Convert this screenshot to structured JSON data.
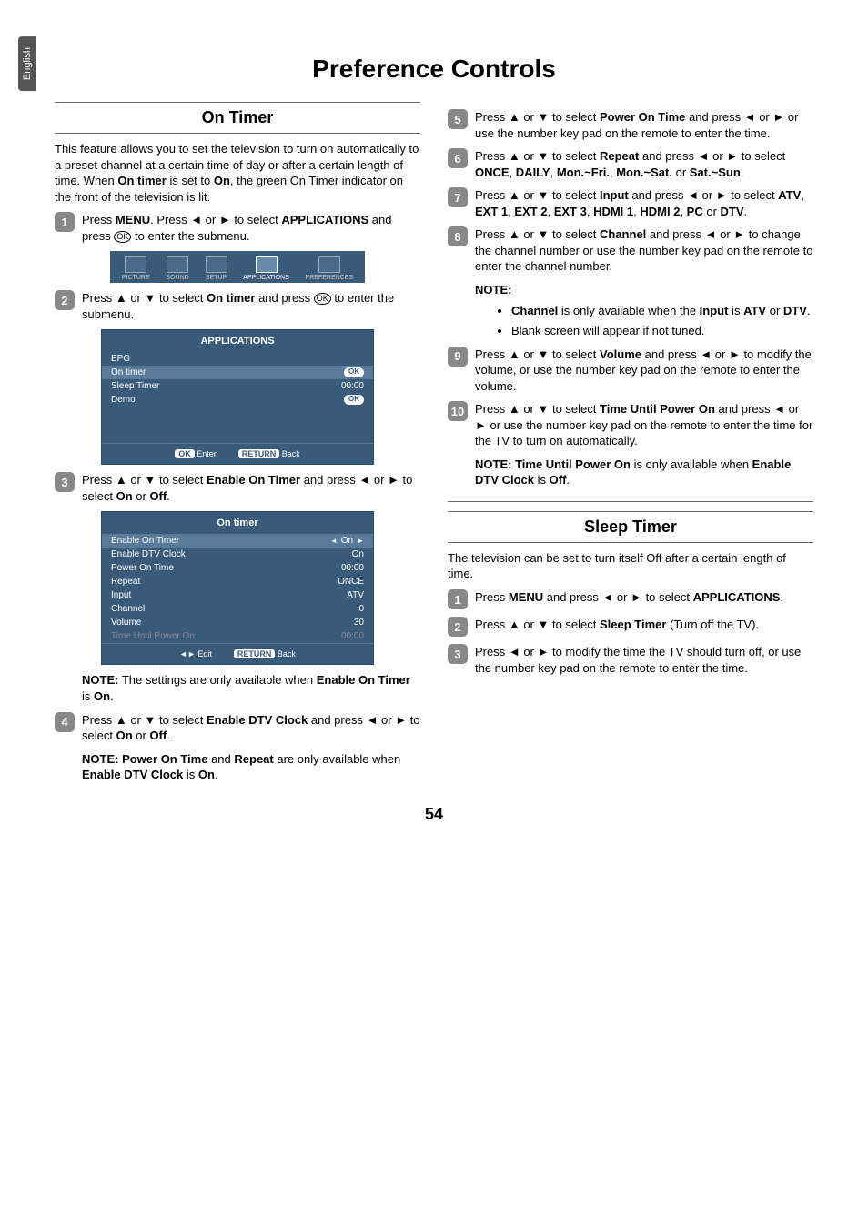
{
  "langTab": "English",
  "mainTitle": "Preference Controls",
  "pageNumber": "54",
  "left": {
    "sectionTitle": "On Timer",
    "intro": "This feature allows you to set the television to turn on automatically to a preset channel at a certain time of day or after a certain length of time. When ",
    "introB1": "On timer",
    "introMid": " is set to ",
    "introB2": "On",
    "introEnd": ", the green On Timer indicator on the front of the television is lit.",
    "s1a": "Press ",
    "s1b": "MENU",
    "s1c": ". Press ◄ or ► to select ",
    "s1d": "APPLICATIONS",
    "s1e": " and press ",
    "s1f": " to enter the submenu.",
    "okGlyph": "OK",
    "s2a": "Press ▲ or ▼ to select ",
    "s2b": "On timer",
    "s2c": " and press ",
    "s2d": " to enter the submenu.",
    "s3a": "Press ▲ or ▼ to select ",
    "s3b": "Enable On Timer",
    "s3c": " and press ◄ or ► to select ",
    "s3d": "On",
    "s3e": " or ",
    "s3f": "Off",
    "s3g": ".",
    "note3Label": "NOTE:",
    "note3a": " The settings are only available when ",
    "note3b": "Enable On Timer",
    "note3c": " is ",
    "note3d": "On",
    "note3e": ".",
    "s4a": "Press ▲ or ▼ to select ",
    "s4b": "Enable DTV Clock",
    "s4c": " and press ◄ or ► to select ",
    "s4d": "On",
    "s4e": " or ",
    "s4f": "Off",
    "s4g": ".",
    "note4Label": "NOTE:",
    "note4a": " Power On Time",
    "note4b": " and ",
    "note4c": "Repeat",
    "note4d": " are only available when ",
    "note4e": "Enable DTV Clock",
    "note4f": " is ",
    "note4g": "On",
    "note4h": "."
  },
  "right": {
    "s5a": "Press ▲ or ▼ to select ",
    "s5b": "Power On Time",
    "s5c": " and press ◄ or ► or use the number key pad on the remote to enter the time.",
    "s6a": "Press ▲ or ▼ to select ",
    "s6b": "Repeat",
    "s6c": " and press ◄ or ► to select ",
    "s6d": "ONCE",
    "s6e": ", ",
    "s6f": "DAILY",
    "s6g": ", ",
    "s6h": "Mon.~Fri.",
    "s6i": ", ",
    "s6j": "Mon.~Sat.",
    "s6k": " or ",
    "s6l": "Sat.~Sun",
    "s6m": ".",
    "s7a": "Press ▲ or ▼ to select ",
    "s7b": "Input",
    "s7c": " and press ◄ or ► to select ",
    "s7d": "ATV",
    "s7e": ", ",
    "s7f": "EXT 1",
    "s7g": ", ",
    "s7h": "EXT 2",
    "s7i": ", ",
    "s7j": "EXT 3",
    "s7k": ", ",
    "s7l": "HDMI 1",
    "s7m": ", ",
    "s7n": "HDMI 2",
    "s7o": ", ",
    "s7p": "PC",
    "s7q": " or ",
    "s7r": "DTV",
    "s7s": ".",
    "s8a": "Press ▲ or ▼ to select ",
    "s8b": "Channel",
    "s8c": " and press ◄ or ► to change the channel number or use the number key pad on the remote to enter the channel number.",
    "note8Label": "NOTE:",
    "b1a": "Channel",
    "b1b": " is only available when the ",
    "b1c": "Input",
    "b1d": " is ",
    "b1e": "ATV",
    "b1f": " or ",
    "b1g": "DTV",
    "b1h": ".",
    "b2": "Blank screen will appear if not tuned.",
    "s9a": "Press ▲ or ▼ to select ",
    "s9b": "Volume",
    "s9c": " and press ◄ or ► to modify the volume, or use the number key pad on the remote to enter the volume.",
    "s10a": "Press ▲ or ▼ to select ",
    "s10b": "Time Until Power On",
    "s10c": " and press ◄ or ► or use the number key pad on the remote to enter the time for the TV to turn on automatically.",
    "note10Label": "NOTE:",
    "note10a": " Time Until Power On",
    "note10b": " is only available when ",
    "note10c": "Enable DTV Clock",
    "note10d": " is ",
    "note10e": "Off",
    "note10f": ".",
    "sleepTitle": "Sleep Timer",
    "sleepIntro": "The television can be set to turn itself Off after a certain length of time.",
    "sl1a": "Press ",
    "sl1b": "MENU",
    "sl1c": " and press ◄ or ► to select ",
    "sl1d": "APPLICATIONS",
    "sl1e": ".",
    "sl2a": "Press ▲ or ▼ to select ",
    "sl2b": "Sleep Timer",
    "sl2c": " (Turn off the TV).",
    "sl3": "Press ◄ or ► to modify the time the TV should turn off, or use the number key pad on the remote to enter the time."
  },
  "menuBar": {
    "items": [
      "PICTURE",
      "SOUND",
      "SETUP",
      "APPLICATIONS",
      "PREFERENCES"
    ]
  },
  "osd1": {
    "title": "APPLICATIONS",
    "rows": [
      {
        "label": "EPG",
        "value": ""
      },
      {
        "label": "On timer",
        "value": "OK"
      },
      {
        "label": "Sleep Timer",
        "value": "00:00"
      },
      {
        "label": "Demo",
        "value": "OK"
      }
    ],
    "footEnter": "Enter",
    "footEnterBtn": "OK",
    "footBack": "Back",
    "footBackBtn": "RETURN"
  },
  "osd2": {
    "title": "On timer",
    "rows": [
      {
        "label": "Enable On Timer",
        "value": "On"
      },
      {
        "label": "Enable DTV Clock",
        "value": "On"
      },
      {
        "label": "Power On Time",
        "value": "00:00"
      },
      {
        "label": "Repeat",
        "value": "ONCE"
      },
      {
        "label": "Input",
        "value": "ATV"
      },
      {
        "label": "Channel",
        "value": "0"
      },
      {
        "label": "Volume",
        "value": "30"
      },
      {
        "label": "Time Until Power On",
        "value": "00:00"
      }
    ],
    "footEdit": "Edit",
    "footBack": "Back",
    "footBackBtn": "RETURN"
  }
}
